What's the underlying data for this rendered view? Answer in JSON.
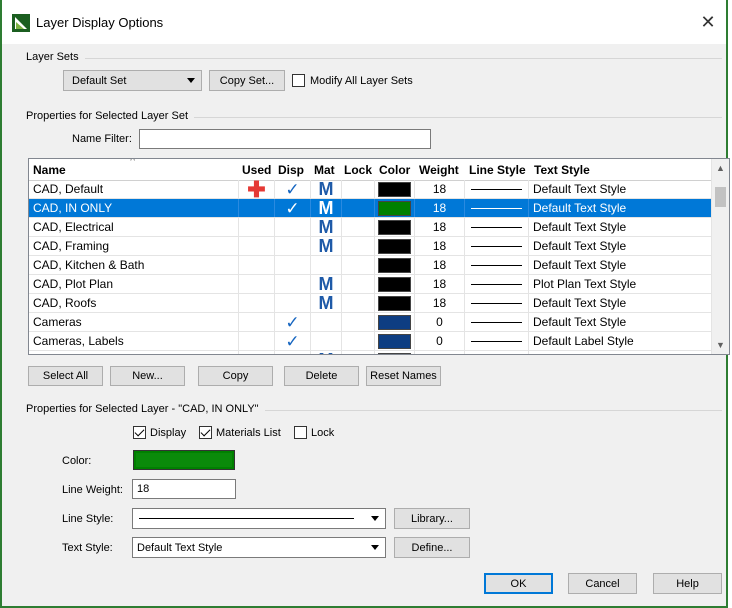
{
  "window": {
    "title": "Layer Display Options",
    "close_glyph": "✕"
  },
  "layer_sets": {
    "group_label": "Layer Sets",
    "selected_set": "Default Set",
    "copy_set_label": "Copy Set...",
    "modify_all_label": "Modify All Layer Sets",
    "modify_all_checked": false
  },
  "properties_set": {
    "group_label": "Properties for Selected Layer Set",
    "name_filter_label": "Name Filter:",
    "name_filter_value": ""
  },
  "table": {
    "columns": [
      "Name",
      "Used",
      "Disp",
      "Mat",
      "Lock",
      "Color",
      "Weight",
      "Line Style",
      "Text Style"
    ],
    "rows": [
      {
        "name": "CAD,  Default",
        "used": true,
        "disp": true,
        "mat": true,
        "lock": false,
        "color": "#000000",
        "weight": "18",
        "text_style": "Default Text Style",
        "selected": false
      },
      {
        "name": "CAD,  IN ONLY",
        "used": false,
        "disp": true,
        "mat": true,
        "lock": false,
        "color": "#008000",
        "weight": "18",
        "text_style": "Default Text Style",
        "selected": true
      },
      {
        "name": "CAD, Electrical",
        "used": false,
        "disp": false,
        "mat": true,
        "lock": false,
        "color": "#000000",
        "weight": "18",
        "text_style": "Default Text Style",
        "selected": false
      },
      {
        "name": "CAD, Framing",
        "used": false,
        "disp": false,
        "mat": true,
        "lock": false,
        "color": "#000000",
        "weight": "18",
        "text_style": "Default Text Style",
        "selected": false
      },
      {
        "name": "CAD, Kitchen & Bath",
        "used": false,
        "disp": false,
        "mat": false,
        "lock": false,
        "color": "#000000",
        "weight": "18",
        "text_style": "Default Text Style",
        "selected": false
      },
      {
        "name": "CAD, Plot Plan",
        "used": false,
        "disp": false,
        "mat": true,
        "lock": false,
        "color": "#000000",
        "weight": "18",
        "text_style": "Plot Plan Text Style",
        "selected": false
      },
      {
        "name": "CAD, Roofs",
        "used": false,
        "disp": false,
        "mat": true,
        "lock": false,
        "color": "#000000",
        "weight": "18",
        "text_style": "Default Text Style",
        "selected": false
      },
      {
        "name": "Cameras",
        "used": false,
        "disp": true,
        "mat": false,
        "lock": false,
        "color": "#0d3d82",
        "weight": "0",
        "text_style": "Default Text Style",
        "selected": false
      },
      {
        "name": "Cameras, Labels",
        "used": false,
        "disp": true,
        "mat": false,
        "lock": false,
        "color": "#0d3d82",
        "weight": "0",
        "text_style": "Default Label Style",
        "selected": false
      },
      {
        "name": "",
        "used": false,
        "disp": true,
        "mat": true,
        "lock": false,
        "color": "#000000",
        "weight": "",
        "text_style": "",
        "selected": false
      }
    ],
    "glyphs": {
      "used": "✚",
      "check": "✓",
      "mat": "M",
      "sort": "^",
      "scroll_up": "▲",
      "scroll_down": "▼"
    }
  },
  "table_buttons": {
    "select_all": "Select All",
    "new": "New...",
    "copy": "Copy",
    "delete": "Delete",
    "reset_names": "Reset Names"
  },
  "layer_props": {
    "group_label": "Properties for Selected Layer - \"CAD,  IN ONLY\"",
    "display_label": "Display",
    "display_checked": true,
    "materials_label": "Materials List",
    "materials_checked": true,
    "lock_label": "Lock",
    "lock_checked": false,
    "color_label": "Color:",
    "color_value": "#008000",
    "line_weight_label": "Line Weight:",
    "line_weight_value": "18",
    "line_style_label": "Line Style:",
    "library_label": "Library...",
    "text_style_label": "Text Style:",
    "text_style_value": "Default Text Style",
    "define_label": "Define..."
  },
  "footer": {
    "ok": "OK",
    "cancel": "Cancel",
    "help": "Help"
  }
}
